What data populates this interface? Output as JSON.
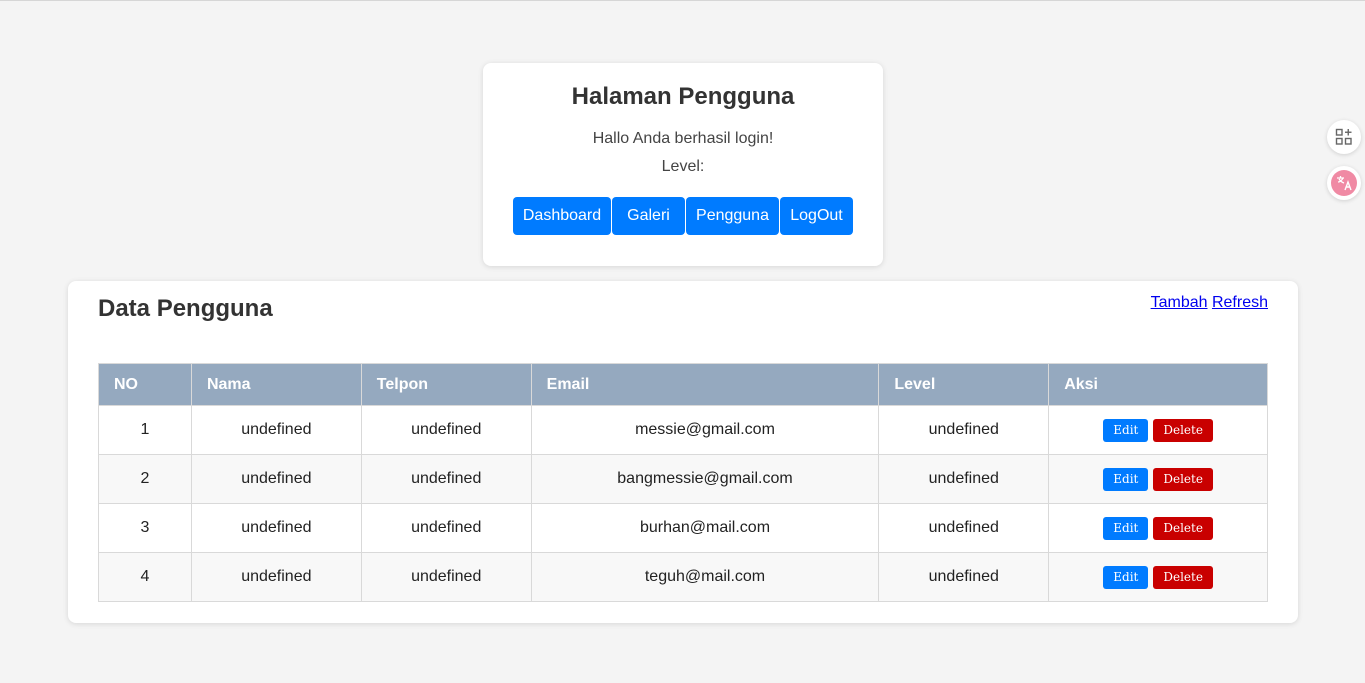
{
  "header": {
    "title": "Halaman Pengguna",
    "welcome": "Hallo Anda berhasil login!",
    "level_label": "Level:",
    "nav": [
      "Dashboard",
      "Galeri",
      "Pengguna",
      "LogOut"
    ]
  },
  "main": {
    "title": "Data Pengguna",
    "add_link": "Tambah",
    "refresh_link": "Refresh",
    "columns": [
      "NO",
      "Nama",
      "Telpon",
      "Email",
      "Level",
      "Aksi"
    ],
    "edit_label": "Edit",
    "delete_label": "Delete",
    "rows": [
      {
        "no": "1",
        "nama": "undefined",
        "telpon": "undefined",
        "email": "messie@gmail.com",
        "level": "undefined"
      },
      {
        "no": "2",
        "nama": "undefined",
        "telpon": "undefined",
        "email": "bangmessie@gmail.com",
        "level": "undefined"
      },
      {
        "no": "3",
        "nama": "undefined",
        "telpon": "undefined",
        "email": "burhan@mail.com",
        "level": "undefined"
      },
      {
        "no": "4",
        "nama": "undefined",
        "telpon": "undefined",
        "email": "teguh@mail.com",
        "level": "undefined"
      }
    ]
  },
  "side_widgets": {
    "apps_icon": "apps-add-icon",
    "translate_icon": "translate-icon"
  },
  "colors": {
    "primary": "#007bff",
    "danger": "#c90000",
    "table_header": "#95a9bf",
    "background": "#f4f4f4"
  }
}
